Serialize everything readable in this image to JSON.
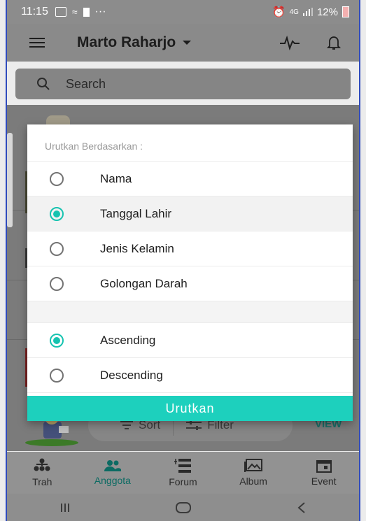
{
  "status_bar": {
    "time": "11:15",
    "dots": "···",
    "network": "4G",
    "battery": "12%"
  },
  "app_bar": {
    "title": "Marto Raharjo"
  },
  "search": {
    "placeholder": "Search"
  },
  "pill": {
    "sort_label": "Sort",
    "filter_label": "Filter"
  },
  "view_label": "VIEW",
  "modal": {
    "title": "Urutkan Berdasarkan :",
    "sort_fields": [
      {
        "label": "Nama",
        "selected": false
      },
      {
        "label": "Tanggal Lahir",
        "selected": true
      },
      {
        "label": "Jenis Kelamin",
        "selected": false
      },
      {
        "label": "Golongan Darah",
        "selected": false
      }
    ],
    "order": [
      {
        "label": "Ascending",
        "selected": true
      },
      {
        "label": "Descending",
        "selected": false
      }
    ],
    "submit_label": "Urutkan"
  },
  "bottom_nav": [
    {
      "label": "Trah",
      "icon": "tree-icon",
      "active": false
    },
    {
      "label": "Anggota",
      "icon": "people-icon",
      "active": true
    },
    {
      "label": "Forum",
      "icon": "forum-icon",
      "active": false
    },
    {
      "label": "Album",
      "icon": "album-icon",
      "active": false
    },
    {
      "label": "Event",
      "icon": "calendar-icon",
      "active": false
    }
  ],
  "colors": {
    "accent": "#1dd0bd",
    "radio_on": "#16c3b0",
    "nav_active": "#0c6b63"
  }
}
